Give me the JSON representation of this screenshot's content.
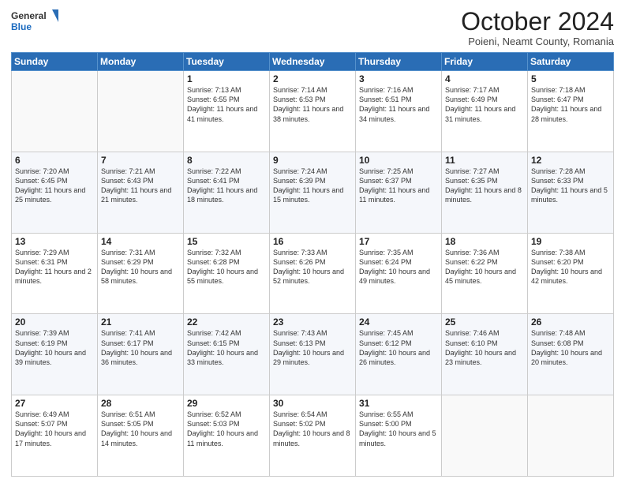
{
  "header": {
    "logo_general": "General",
    "logo_blue": "Blue",
    "month_title": "October 2024",
    "subtitle": "Poieni, Neamt County, Romania"
  },
  "days_of_week": [
    "Sunday",
    "Monday",
    "Tuesday",
    "Wednesday",
    "Thursday",
    "Friday",
    "Saturday"
  ],
  "weeks": [
    [
      {
        "day": "",
        "info": ""
      },
      {
        "day": "",
        "info": ""
      },
      {
        "day": "1",
        "info": "Sunrise: 7:13 AM\nSunset: 6:55 PM\nDaylight: 11 hours and 41 minutes."
      },
      {
        "day": "2",
        "info": "Sunrise: 7:14 AM\nSunset: 6:53 PM\nDaylight: 11 hours and 38 minutes."
      },
      {
        "day": "3",
        "info": "Sunrise: 7:16 AM\nSunset: 6:51 PM\nDaylight: 11 hours and 34 minutes."
      },
      {
        "day": "4",
        "info": "Sunrise: 7:17 AM\nSunset: 6:49 PM\nDaylight: 11 hours and 31 minutes."
      },
      {
        "day": "5",
        "info": "Sunrise: 7:18 AM\nSunset: 6:47 PM\nDaylight: 11 hours and 28 minutes."
      }
    ],
    [
      {
        "day": "6",
        "info": "Sunrise: 7:20 AM\nSunset: 6:45 PM\nDaylight: 11 hours and 25 minutes."
      },
      {
        "day": "7",
        "info": "Sunrise: 7:21 AM\nSunset: 6:43 PM\nDaylight: 11 hours and 21 minutes."
      },
      {
        "day": "8",
        "info": "Sunrise: 7:22 AM\nSunset: 6:41 PM\nDaylight: 11 hours and 18 minutes."
      },
      {
        "day": "9",
        "info": "Sunrise: 7:24 AM\nSunset: 6:39 PM\nDaylight: 11 hours and 15 minutes."
      },
      {
        "day": "10",
        "info": "Sunrise: 7:25 AM\nSunset: 6:37 PM\nDaylight: 11 hours and 11 minutes."
      },
      {
        "day": "11",
        "info": "Sunrise: 7:27 AM\nSunset: 6:35 PM\nDaylight: 11 hours and 8 minutes."
      },
      {
        "day": "12",
        "info": "Sunrise: 7:28 AM\nSunset: 6:33 PM\nDaylight: 11 hours and 5 minutes."
      }
    ],
    [
      {
        "day": "13",
        "info": "Sunrise: 7:29 AM\nSunset: 6:31 PM\nDaylight: 11 hours and 2 minutes."
      },
      {
        "day": "14",
        "info": "Sunrise: 7:31 AM\nSunset: 6:29 PM\nDaylight: 10 hours and 58 minutes."
      },
      {
        "day": "15",
        "info": "Sunrise: 7:32 AM\nSunset: 6:28 PM\nDaylight: 10 hours and 55 minutes."
      },
      {
        "day": "16",
        "info": "Sunrise: 7:33 AM\nSunset: 6:26 PM\nDaylight: 10 hours and 52 minutes."
      },
      {
        "day": "17",
        "info": "Sunrise: 7:35 AM\nSunset: 6:24 PM\nDaylight: 10 hours and 49 minutes."
      },
      {
        "day": "18",
        "info": "Sunrise: 7:36 AM\nSunset: 6:22 PM\nDaylight: 10 hours and 45 minutes."
      },
      {
        "day": "19",
        "info": "Sunrise: 7:38 AM\nSunset: 6:20 PM\nDaylight: 10 hours and 42 minutes."
      }
    ],
    [
      {
        "day": "20",
        "info": "Sunrise: 7:39 AM\nSunset: 6:19 PM\nDaylight: 10 hours and 39 minutes."
      },
      {
        "day": "21",
        "info": "Sunrise: 7:41 AM\nSunset: 6:17 PM\nDaylight: 10 hours and 36 minutes."
      },
      {
        "day": "22",
        "info": "Sunrise: 7:42 AM\nSunset: 6:15 PM\nDaylight: 10 hours and 33 minutes."
      },
      {
        "day": "23",
        "info": "Sunrise: 7:43 AM\nSunset: 6:13 PM\nDaylight: 10 hours and 29 minutes."
      },
      {
        "day": "24",
        "info": "Sunrise: 7:45 AM\nSunset: 6:12 PM\nDaylight: 10 hours and 26 minutes."
      },
      {
        "day": "25",
        "info": "Sunrise: 7:46 AM\nSunset: 6:10 PM\nDaylight: 10 hours and 23 minutes."
      },
      {
        "day": "26",
        "info": "Sunrise: 7:48 AM\nSunset: 6:08 PM\nDaylight: 10 hours and 20 minutes."
      }
    ],
    [
      {
        "day": "27",
        "info": "Sunrise: 6:49 AM\nSunset: 5:07 PM\nDaylight: 10 hours and 17 minutes."
      },
      {
        "day": "28",
        "info": "Sunrise: 6:51 AM\nSunset: 5:05 PM\nDaylight: 10 hours and 14 minutes."
      },
      {
        "day": "29",
        "info": "Sunrise: 6:52 AM\nSunset: 5:03 PM\nDaylight: 10 hours and 11 minutes."
      },
      {
        "day": "30",
        "info": "Sunrise: 6:54 AM\nSunset: 5:02 PM\nDaylight: 10 hours and 8 minutes."
      },
      {
        "day": "31",
        "info": "Sunrise: 6:55 AM\nSunset: 5:00 PM\nDaylight: 10 hours and 5 minutes."
      },
      {
        "day": "",
        "info": ""
      },
      {
        "day": "",
        "info": ""
      }
    ]
  ]
}
